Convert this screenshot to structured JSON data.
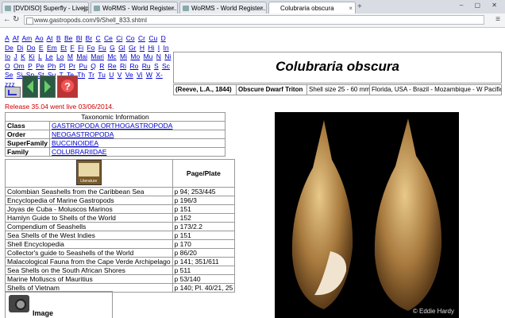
{
  "browser": {
    "tabs": [
      {
        "title": "[DVDISO] Superfly - Livejpfile..."
      },
      {
        "title": "WoRMS - World Register..."
      },
      {
        "title": "WoRMS - World Register..."
      },
      {
        "title": "Colubraria obscura",
        "active": true
      }
    ],
    "url": "www.gastropods.com/9/Shell_833.shtml"
  },
  "alphabet": [
    "A",
    "Af",
    "Am",
    "Ao",
    "At",
    "B",
    "Be",
    "Bl",
    "Br",
    "C",
    "Ce",
    "Ci",
    "Co",
    "Cr",
    "Cu",
    "D",
    "De",
    "Di",
    "Do",
    "E",
    "Em",
    "Et",
    "F",
    "Fi",
    "Fo",
    "Fu",
    "G",
    "Gl",
    "Gr",
    "H",
    "Hi",
    "I",
    "In",
    "Io",
    "J",
    "K",
    "Ki",
    "L",
    "Le",
    "Lo",
    "M",
    "Mai",
    "Mari",
    "Mc",
    "Mi",
    "Mo",
    "Mu",
    "N",
    "Ni",
    "O",
    "Om",
    "P",
    "Pe",
    "Ph",
    "Pl",
    "Pr",
    "Pu",
    "Q",
    "R",
    "Re",
    "Ri",
    "Ro",
    "Ru",
    "S",
    "Sc",
    "Se",
    "Si",
    "Sp",
    "St",
    "Su",
    "T",
    "Te",
    "Th",
    "Tr",
    "Tu",
    "U",
    "V",
    "Ve",
    "Vi",
    "W",
    "X-zzz"
  ],
  "release": "Release 35.04 went live 03/06/2014.",
  "species": {
    "title": "Colubraria obscura",
    "author": "(Reeve, L.A., 1844)",
    "common_name": "Obscure Dwarf Triton",
    "size": "Shell size 25 - 60 mm",
    "distribution": "Florida, USA - Brazil - Mozambique - W Pacific"
  },
  "taxonomy": {
    "header": "Taxonomic Information",
    "rows": [
      {
        "label": "Class",
        "value": "GASTROPODA ORTHOGASTROPODA"
      },
      {
        "label": "Order",
        "value": "NEOGASTROPODA"
      },
      {
        "label": "SuperFamily",
        "value": "BUCCINOIDEA"
      },
      {
        "label": "Family",
        "value": "COLUBRARIIDAE"
      }
    ]
  },
  "literature": {
    "icon_label": "Literature",
    "page_header": "Page/Plate",
    "rows": [
      {
        "book": "Colombian Seashells from the Caribbean Sea",
        "page": "p 94; 253/445"
      },
      {
        "book": "Encyclopedia of Marine Gastropods",
        "page": "p 196/3"
      },
      {
        "book": "Joyas de Cuba - Moluscos Marinos",
        "page": "p 151"
      },
      {
        "book": "Hamlyn Guide to Shells of the World",
        "page": "p 152"
      },
      {
        "book": "Compendium of Seashells",
        "page": "p 173/2.2"
      },
      {
        "book": "Sea Shells of the West Indies",
        "page": "p 151"
      },
      {
        "book": "Shell Encyclopedia",
        "page": "p 170"
      },
      {
        "book": "Collector's guide to Seashells of the World",
        "page": "p 86/20"
      },
      {
        "book": "Malacological Fauna from the Cape Verde Archipelago",
        "page": "p 141; 351/611"
      },
      {
        "book": "Sea Shells on the South African Shores",
        "page": "p 511"
      },
      {
        "book": "Marine Molluscs of Mauritius",
        "page": "p 53/140"
      },
      {
        "book": "Shells of Vietnam",
        "page": "p 140; Pl. 40/21, 25"
      }
    ]
  },
  "image": {
    "copyright": "© Eddie Hardy"
  },
  "image_ack": "Image Acknowledgments"
}
